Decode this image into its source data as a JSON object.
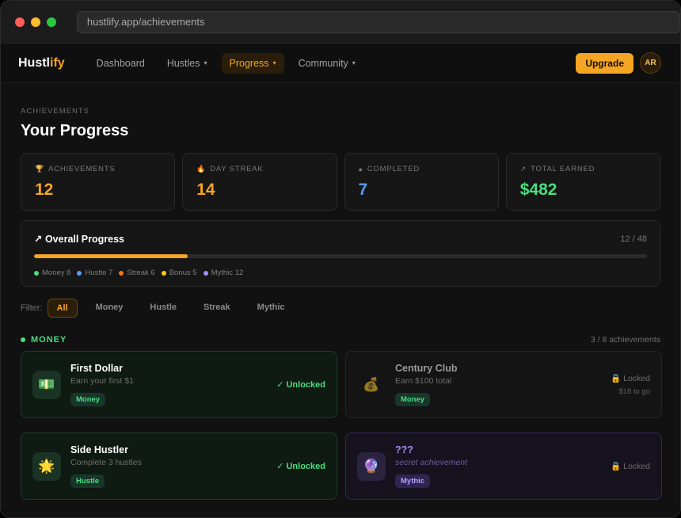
{
  "browser": {
    "url": "hustlify.app/achievements"
  },
  "nav": {
    "logo_main": "Hustl",
    "logo_accent": "ify",
    "items": [
      {
        "label": "Dashboard",
        "caret": ""
      },
      {
        "label": "Hustles",
        "caret": "▾"
      },
      {
        "label": "Progress",
        "caret": "▾"
      },
      {
        "label": "Community",
        "caret": "▾"
      }
    ],
    "active_item": "Progress",
    "upgrade_label": "Upgrade",
    "avatar_initials": "AR"
  },
  "page": {
    "eyebrow": "ACHIEVEMENTS",
    "title": "Your Progress"
  },
  "stats": [
    {
      "icon": "trophy-icon",
      "glyph": "🏆",
      "label": "ACHIEVEMENTS",
      "value": "12",
      "color": "#f5a524"
    },
    {
      "icon": "flame-icon",
      "glyph": "🔥",
      "label": "DAY STREAK",
      "value": "14",
      "color": "#f5a524"
    },
    {
      "icon": "check-circle-icon",
      "glyph": "●",
      "label": "COMPLETED",
      "value": "7",
      "color": "#5b9cf6"
    },
    {
      "icon": "trend-up-icon",
      "glyph": "↗",
      "label": "TOTAL EARNED",
      "value": "$482",
      "color": "#4ade80"
    }
  ],
  "overall": {
    "title": "↗ Overall Progress",
    "count": "12 / 48",
    "progress_fraction": 0.25,
    "legend": [
      {
        "label": "Money 8",
        "color": "#4ade80"
      },
      {
        "label": "Hustle 7",
        "color": "#5b9cf6"
      },
      {
        "label": "Streak 6",
        "color": "#f97316"
      },
      {
        "label": "Bonus 5",
        "color": "#facc15"
      },
      {
        "label": "Mythic 12",
        "color": "#a78bfa"
      }
    ]
  },
  "filters": {
    "label": "Filter:",
    "options": [
      "All",
      "Money",
      "Hustle",
      "Streak",
      "Mythic"
    ],
    "active": "All"
  },
  "section": {
    "title": "MONEY",
    "count": "3 / 8 achievements"
  },
  "cards": [
    {
      "state": "unlocked",
      "icon": "money-icon",
      "glyph": "💵",
      "title": "First Dollar",
      "desc": "Earn your first $1",
      "tag": "Money",
      "tag_class": "money",
      "status": "✓ Unlocked",
      "status_sub": ""
    },
    {
      "state": "locked",
      "icon": "money-bag-icon",
      "glyph": "💰",
      "title": "Century Club",
      "desc": "Earn $100 total",
      "tag": "Money",
      "tag_class": "money",
      "status": "🔒 Locked",
      "status_sub": "$18 to go"
    },
    {
      "state": "unlocked",
      "icon": "sun-icon",
      "glyph": "🌟",
      "title": "Side Hustler",
      "desc": "Complete 3 hustles",
      "tag": "Hustle",
      "tag_class": "hustle",
      "status": "✓ Unlocked",
      "status_sub": ""
    },
    {
      "state": "mythic",
      "icon": "crystal-icon",
      "glyph": "🔮",
      "title": "???",
      "desc": "secret achievement",
      "tag": "Mythic",
      "tag_class": "mythic",
      "status": "🔒 Locked",
      "status_sub": ""
    }
  ]
}
